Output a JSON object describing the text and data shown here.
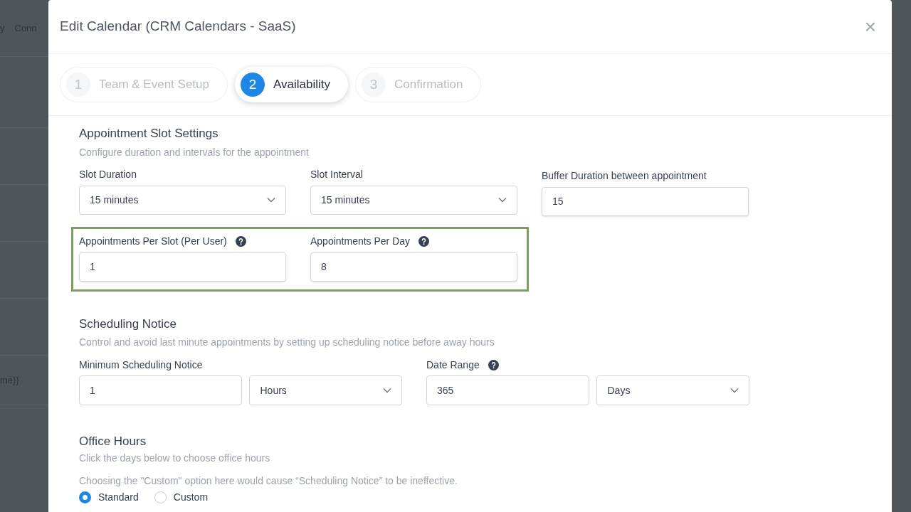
{
  "background": {
    "top_items": [
      "y",
      "Conn"
    ],
    "fragment": "me}}"
  },
  "dialog": {
    "title": "Edit Calendar (CRM Calendars - SaaS)",
    "close": "×",
    "steps": [
      {
        "number": "1",
        "label": "Team & Event Setup",
        "selected": false
      },
      {
        "number": "2",
        "label": "Availability",
        "selected": true
      },
      {
        "number": "3",
        "label": "Confirmation",
        "selected": false
      }
    ]
  },
  "slot_settings": {
    "title": "Appointment Slot Settings",
    "description": "Configure duration and intervals for the appointment",
    "row_1": [
      {
        "kind": "select",
        "label": "Slot Duration",
        "value": "15 minutes",
        "help": false
      },
      {
        "kind": "select",
        "label": "Slot Interval",
        "value": "15 minutes",
        "help": false
      },
      {
        "kind": "input",
        "label": "Buffer Duration between appointment",
        "value": "15",
        "help": false
      }
    ],
    "row_2": [
      {
        "kind": "input",
        "label": "Appointments Per Slot (Per User)",
        "value": "1",
        "help": true
      },
      {
        "kind": "input",
        "label": "Appointments Per Day",
        "value": "8",
        "help": true
      }
    ]
  },
  "scheduling_notice": {
    "title": "Scheduling Notice",
    "description": "Control and avoid last minute appointments by setting up scheduling notice before away hours",
    "groups": [
      {
        "label": "Minimum Scheduling Notice",
        "help": false,
        "value": "1",
        "unit": "Hours"
      },
      {
        "label": "Date Range",
        "help": true,
        "value": "365",
        "unit": "Days"
      }
    ]
  },
  "office_hours": {
    "title": "Office Hours",
    "description": "Click the days below to choose office hours",
    "note": "Choosing the \"Custom\" option here would cause “Scheduling Notice” to be ineffective.",
    "options": [
      {
        "label": "Standard",
        "selected": true
      },
      {
        "label": "Custom",
        "selected": false
      }
    ]
  }
}
